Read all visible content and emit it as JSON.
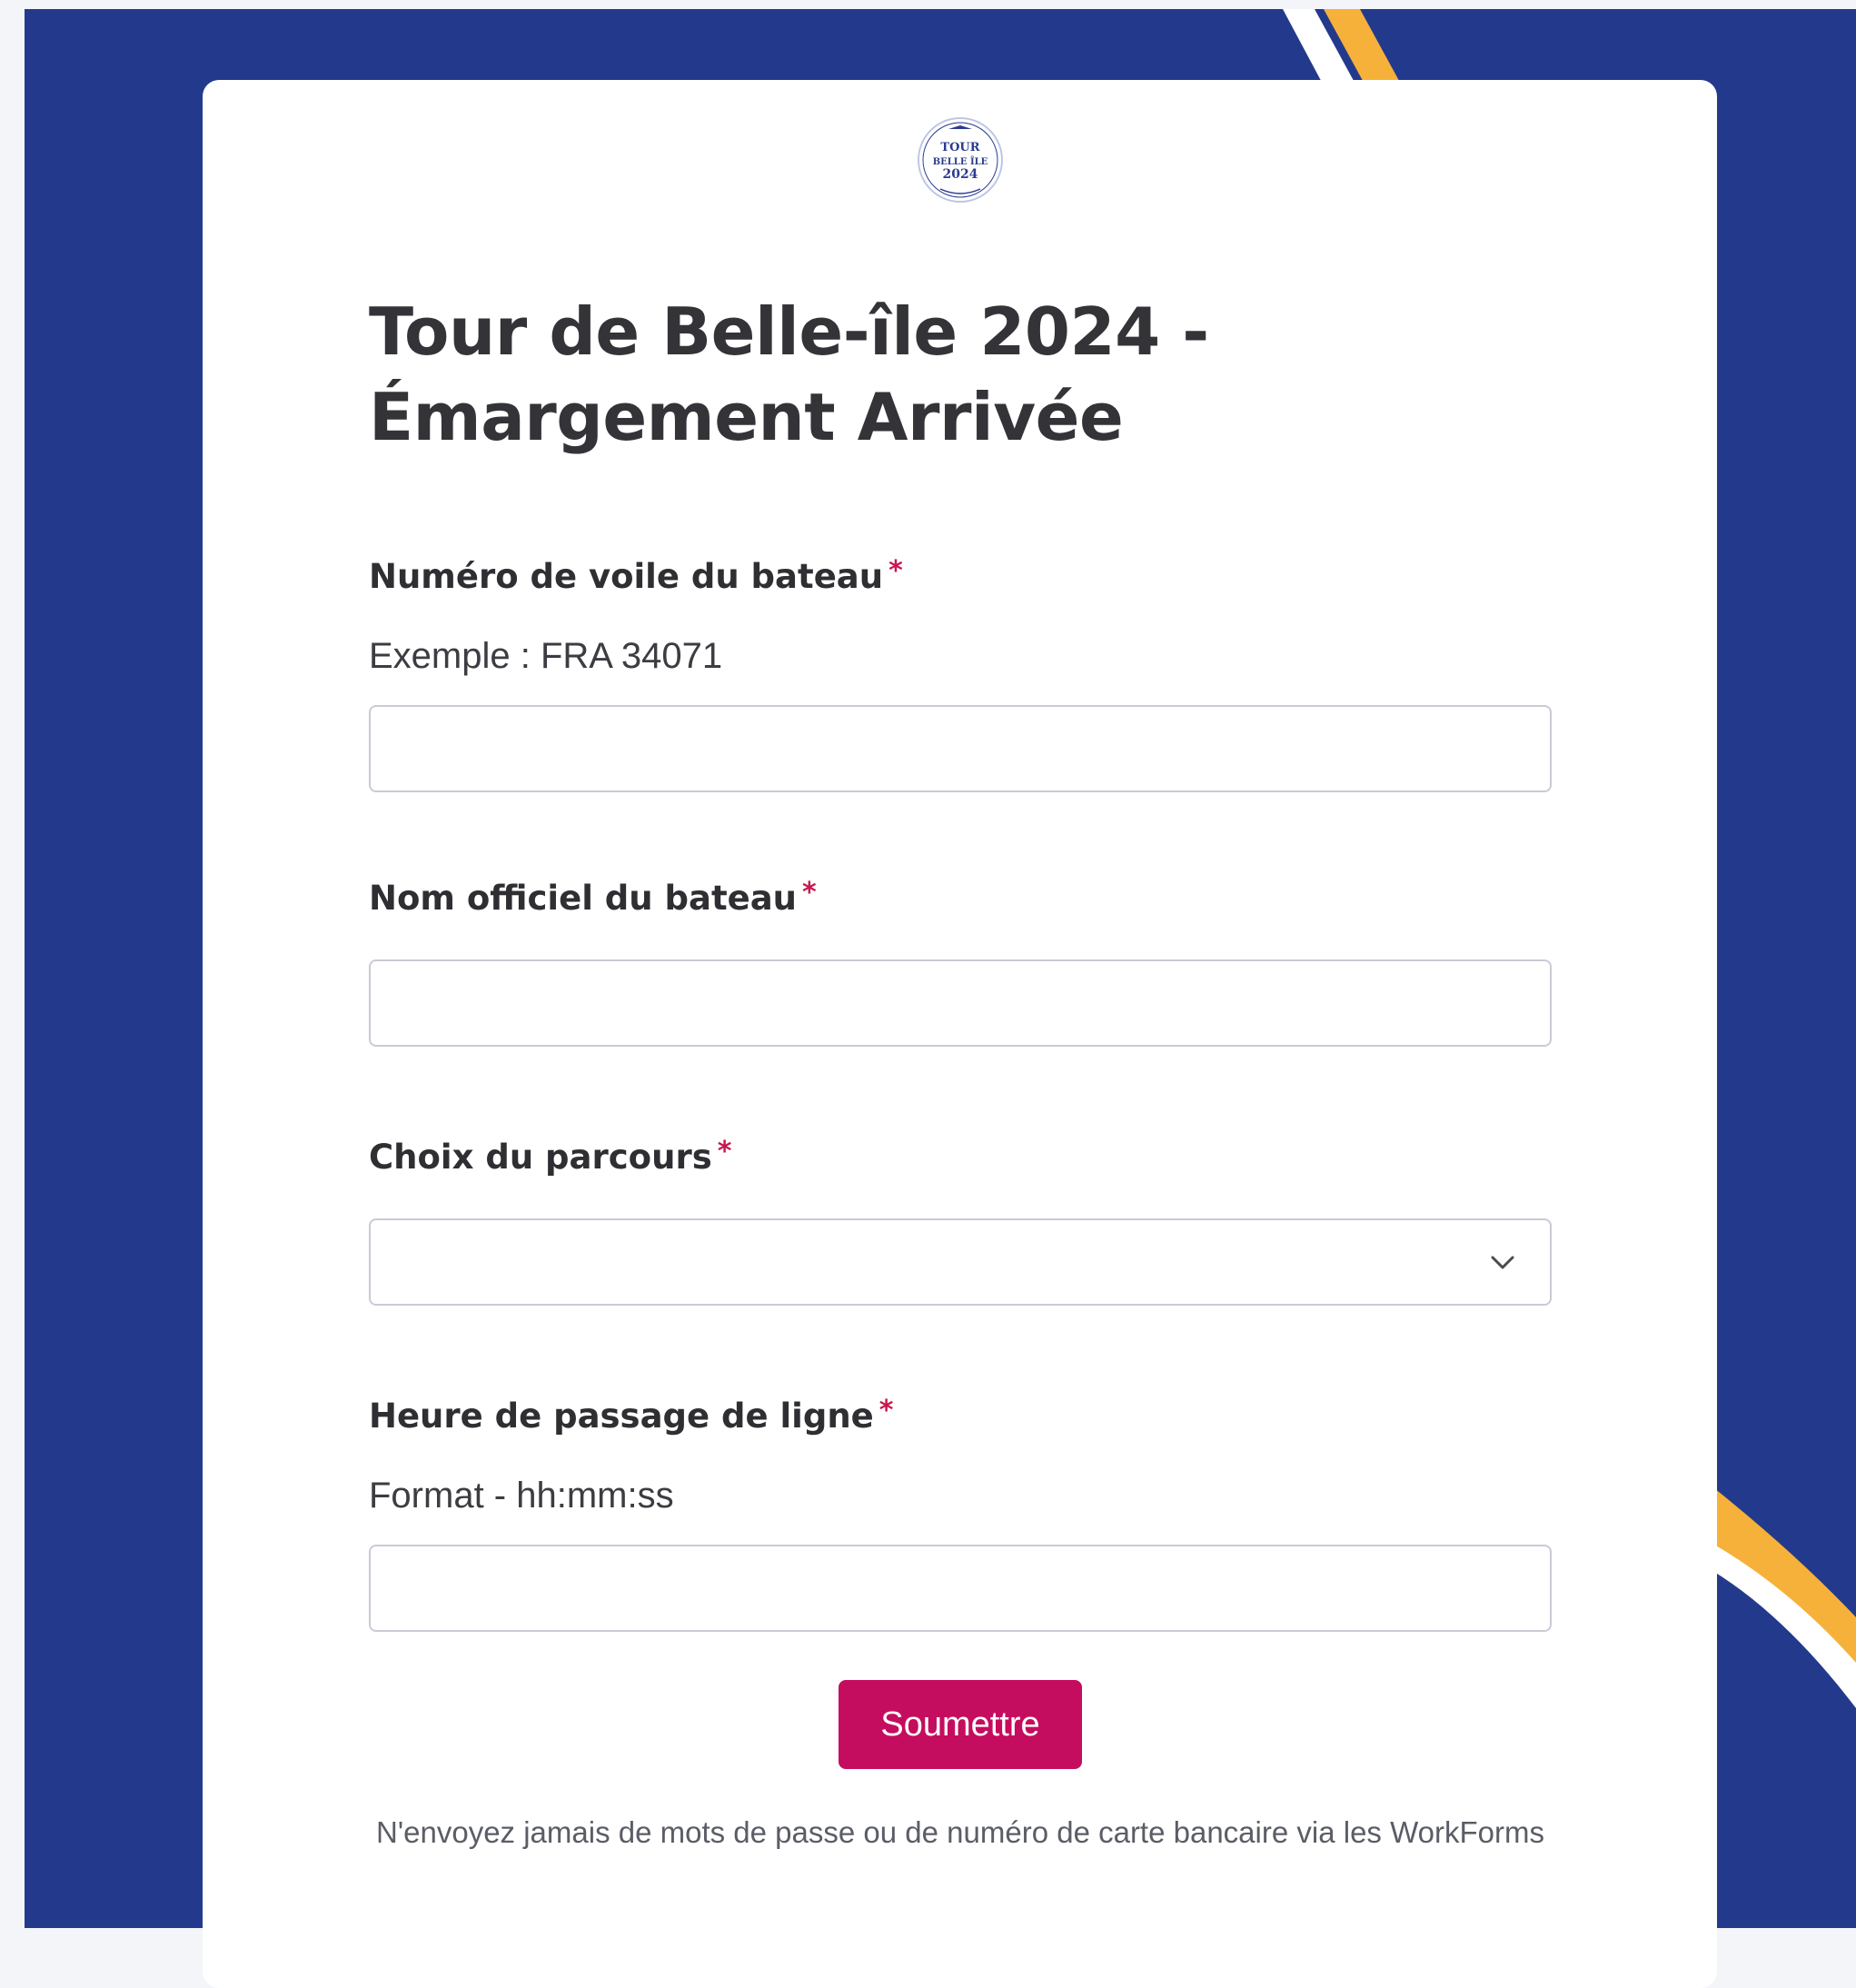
{
  "form": {
    "title": "Tour de Belle-île 2024 - Émargement Arrivée",
    "logo": {
      "icon": "event-logo",
      "line1": "TOUR",
      "line2": "BELLE ÎLE",
      "line3": "2024"
    },
    "fields": [
      {
        "label": "Numéro de voile du bateau",
        "required_mark": "*",
        "hint": "Exemple : FRA 34071",
        "value": "",
        "type": "text"
      },
      {
        "label": "Nom officiel du bateau",
        "required_mark": "*",
        "value": "",
        "type": "text"
      },
      {
        "label": "Choix du parcours",
        "required_mark": "*",
        "value": "",
        "type": "select",
        "icon": "chevron-down-icon"
      },
      {
        "label": "Heure de passage de ligne",
        "required_mark": "*",
        "hint": "Format - hh:mm:ss",
        "value": "",
        "type": "text"
      }
    ],
    "submit_label": "Soumettre",
    "disclaimer": "N'envoyez jamais de mots de passe ou de numéro de carte bancaire via les WorkForms"
  },
  "colors": {
    "background": "#233a8c",
    "accent_stripe": "#f6b13a",
    "submit_button": "#c50d5f",
    "required_mark": "#c8184f"
  }
}
